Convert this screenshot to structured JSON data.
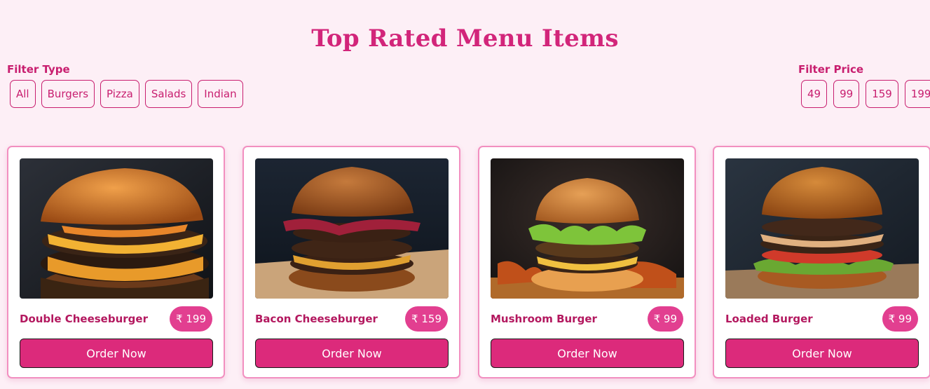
{
  "page": {
    "title": "Top Rated Menu Items"
  },
  "filters": {
    "type": {
      "label": "Filter Type",
      "options": [
        "All",
        "Burgers",
        "Pizza",
        "Salads",
        "Indian"
      ]
    },
    "price": {
      "label": "Filter Price",
      "options": [
        "49",
        "99",
        "159",
        "199"
      ]
    }
  },
  "items": [
    {
      "name": "Double Cheeseburger",
      "price": "₹ 199",
      "button": "Order Now",
      "image": "double-cheeseburger-photo"
    },
    {
      "name": "Bacon Cheeseburger",
      "price": "₹ 159",
      "button": "Order Now",
      "image": "bacon-cheeseburger-photo"
    },
    {
      "name": "Mushroom Burger",
      "price": "₹ 99",
      "button": "Order Now",
      "image": "mushroom-burger-photo"
    },
    {
      "name": "Loaded Burger",
      "price": "₹ 99",
      "button": "Order Now",
      "image": "loaded-burger-photo"
    }
  ],
  "colors": {
    "background": "#fdeff6",
    "accent": "#dc2a7b",
    "title": "#d2257a",
    "price_badge": "#e23f90",
    "card_border": "#f28fc0"
  }
}
